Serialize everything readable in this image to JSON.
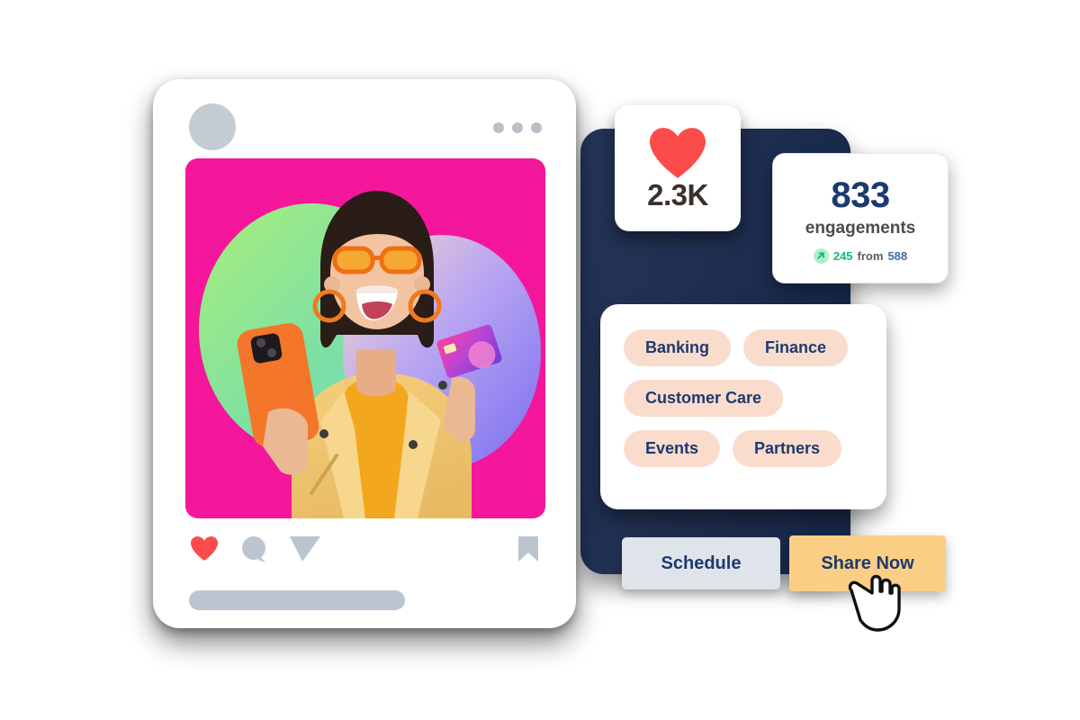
{
  "post": {
    "header": {
      "avatar_name": "avatar",
      "more_menu_label": "more-options"
    },
    "photo": {
      "alt": "Smiling woman in yellow jacket with orange sunglasses holding an orange phone and a colorful card on a magenta background",
      "background_color": "#f4169b",
      "blob_green": "#8ce07f",
      "blob_purple": "#9b8cf0"
    },
    "actions": {
      "like_icon": "heart-icon",
      "comment_icon": "comment-icon",
      "send_icon": "send-icon",
      "save_icon": "bookmark-icon",
      "like_color": "#fc4b4b",
      "idle_color": "#bcc4cf"
    }
  },
  "likes_card": {
    "icon": "heart-icon",
    "count": "2.3K",
    "heart_color": "#fc4b4b",
    "count_color": "#3a302c"
  },
  "engagements_card": {
    "number": "833",
    "label": "engagements",
    "delta_icon": "arrow-up-right-icon",
    "delta_value": "245",
    "delta_connector": "from",
    "delta_base": "588",
    "number_color": "#1c3a6e",
    "delta_up_color": "#14b86e",
    "delta_base_color": "#3f6ba6"
  },
  "tags_card": {
    "pill_bg": "#fadccd",
    "pill_text_color": "#1c3a6e",
    "rows": [
      [
        "Banking",
        "Finance"
      ],
      [
        "Customer Care"
      ],
      [
        "Events",
        "Partners"
      ]
    ]
  },
  "actions_bar": {
    "schedule_label": "Schedule",
    "schedule_bg": "#dfe4ea",
    "share_label": "Share Now",
    "share_bg": "#facf85",
    "cursor": "pointer-hand-cursor"
  },
  "theme": {
    "panel_navy": "#1b2c51",
    "card_white": "#ffffff",
    "page_bg": "#ffffff"
  }
}
